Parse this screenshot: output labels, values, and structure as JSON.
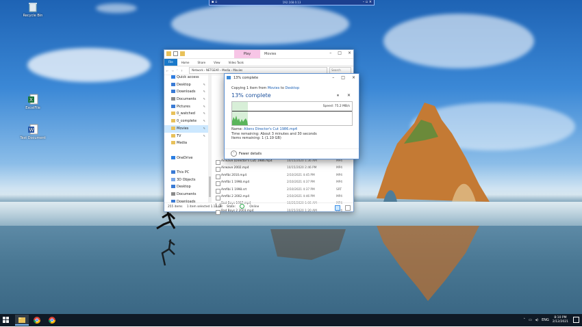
{
  "remote": {
    "address": "192.168.0.13"
  },
  "desktop_icons": [
    {
      "label": "Recycle Bin"
    },
    {
      "label": "ExcelFile"
    },
    {
      "label": "Test Document"
    }
  ],
  "explorer": {
    "qat_tab": "Play",
    "window_title": "Movies",
    "ribbon_tabs": [
      "File",
      "Home",
      "Share",
      "View",
      "Video Tools"
    ],
    "path": "Network  ›  NETGEAR  ›  Media  ›  Movies",
    "search_placeholder": "Search",
    "nav_items": [
      {
        "label": "Quick access",
        "pinned": false,
        "selected": false,
        "color": "#2f7de1"
      },
      {
        "label": "Desktop",
        "pinned": true,
        "selected": false,
        "color": "#3a7bd5"
      },
      {
        "label": "Downloads",
        "pinned": true,
        "selected": false,
        "color": "#3a7bd5"
      },
      {
        "label": "Documents",
        "pinned": true,
        "selected": false,
        "color": "#8a8a8a"
      },
      {
        "label": "Pictures",
        "pinned": true,
        "selected": false,
        "color": "#3a7bd5"
      },
      {
        "label": "0_watched",
        "pinned": true,
        "selected": false,
        "color": "#e8c15a"
      },
      {
        "label": "0_complete",
        "pinned": true,
        "selected": false,
        "color": "#e8c15a"
      },
      {
        "label": "Movies",
        "pinned": true,
        "selected": true,
        "color": "#e8c15a"
      },
      {
        "label": "TV",
        "pinned": true,
        "selected": false,
        "color": "#e8c15a"
      },
      {
        "label": "Media",
        "pinned": false,
        "selected": false,
        "color": "#e8c15a"
      },
      {
        "label": "",
        "pinned": false,
        "selected": false,
        "color": ""
      },
      {
        "label": "OneDrive",
        "pinned": false,
        "selected": false,
        "color": "#2a7de1"
      },
      {
        "label": "",
        "pinned": false,
        "selected": false,
        "color": ""
      },
      {
        "label": "This PC",
        "pinned": false,
        "selected": false,
        "color": "#3a7bd5"
      },
      {
        "label": "3D Objects",
        "pinned": false,
        "selected": false,
        "color": "#7aa7e6"
      },
      {
        "label": "Desktop",
        "pinned": false,
        "selected": false,
        "color": "#3a7bd5"
      },
      {
        "label": "Documents",
        "pinned": false,
        "selected": false,
        "color": "#8a8a8a"
      },
      {
        "label": "Downloads",
        "pinned": false,
        "selected": false,
        "color": "#3a7bd5"
      }
    ],
    "files": [
      {
        "name": "Airwave (Director's Cut) 1986.mp4",
        "date": "10/15/2020 1:36 AM",
        "type": "MP4"
      },
      {
        "name": "Airwave 2002.mp4",
        "date": "10/15/2020 2:46 PM",
        "type": "MP4"
      },
      {
        "name": "Amfibi 2010.mp4",
        "date": "2/10/2021 4:45 PM",
        "type": "MP4"
      },
      {
        "name": "Amfibi 1 1998.mp4",
        "date": "2/10/2021 4:37 PM",
        "type": "MP4"
      },
      {
        "name": "Amfibi 1 1998.srt",
        "date": "2/10/2021 4:37 PM",
        "type": "SRT"
      },
      {
        "name": "Amfibi 2 2002.mp4",
        "date": "2/10/2021 4:46 PM",
        "type": "MP4"
      },
      {
        "name": "Bad Boys 1987.mp4",
        "date": "10/25/2020 1:06 AM",
        "type": "MP4"
      },
      {
        "name": "Bad Boys 2 2003.mp4",
        "date": "10/25/2020 1:20 AM",
        "type": "MP4"
      }
    ],
    "status": {
      "items": "255 items",
      "selected": "1 item selected  1.12 GB",
      "state_label": "State:",
      "state_value": "Online"
    }
  },
  "copy_dialog": {
    "title": "13% complete",
    "from_prefix": "Copying 1 item from ",
    "from": "Movies",
    "to_prefix": " to ",
    "to": "Desktop",
    "percent_label": "13% complete",
    "progress_fraction": 0.13,
    "pause_icon": "pause-icon",
    "cancel_icon": "close-icon",
    "speed": "Speed: 75.2 MB/s",
    "name_label": "Name: ",
    "name_value": "Aliens Director's Cut 1986.mp4",
    "time_label": "Time remaining: ",
    "time_value": "About 3 minutes and 30 seconds",
    "items_label": "Items remaining: ",
    "items_value": "1 (1.19 GB)",
    "fewer_details": "Fewer details"
  },
  "taskbar": {
    "apps": [
      "file-explorer",
      "chrome",
      "chrome"
    ],
    "tray_lang": "ENG",
    "time": "8:10 PM",
    "date": "2/12/2021"
  },
  "colors": {
    "accent": "#1979ca",
    "progress_fill": "#d8efd8",
    "graph_line": "#4caf50"
  }
}
